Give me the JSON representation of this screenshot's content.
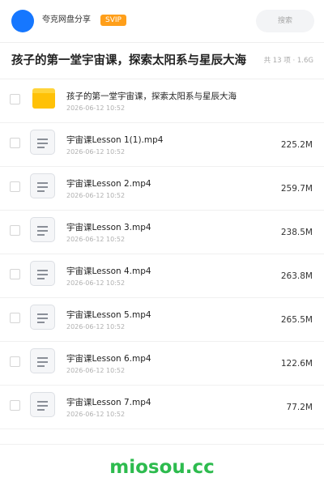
{
  "header": {
    "site_name": "夸克网盘分享",
    "badge": "SVIP",
    "search_placeholder": "搜索"
  },
  "folder": {
    "title": "孩子的第一堂宇宙课，探索太阳系与星辰大海",
    "summary": "共 13 项 · 1.6G"
  },
  "items": [
    {
      "type": "folder",
      "name": "孩子的第一堂宇宙课，探索太阳系与星辰大海",
      "date": "2026-06-12 10:52",
      "size": ""
    },
    {
      "type": "file",
      "name": "宇宙课Lesson 1(1).mp4",
      "date": "2026-06-12 10:52",
      "size": "225.2M"
    },
    {
      "type": "file",
      "name": "宇宙课Lesson 2.mp4",
      "date": "2026-06-12 10:52",
      "size": "259.7M"
    },
    {
      "type": "file",
      "name": "宇宙课Lesson 3.mp4",
      "date": "2026-06-12 10:52",
      "size": "238.5M"
    },
    {
      "type": "file",
      "name": "宇宙课Lesson 4.mp4",
      "date": "2026-06-12 10:52",
      "size": "263.8M"
    },
    {
      "type": "file",
      "name": "宇宙课Lesson 5.mp4",
      "date": "2026-06-12 10:52",
      "size": "265.5M"
    },
    {
      "type": "file",
      "name": "宇宙课Lesson 6.mp4",
      "date": "2026-06-12 10:52",
      "size": "122.6M"
    },
    {
      "type": "file",
      "name": "宇宙课Lesson 7.mp4",
      "date": "2026-06-12 10:52",
      "size": "77.2M"
    }
  ],
  "watermark": "miosou.cc",
  "colors": {
    "avatar": "#1677ff",
    "badge": "#ff9f1a",
    "folder_icon": "#ffc107",
    "watermark": "#2dbb4e"
  },
  "icons": {
    "folder": "folder-icon",
    "file": "document-icon"
  }
}
